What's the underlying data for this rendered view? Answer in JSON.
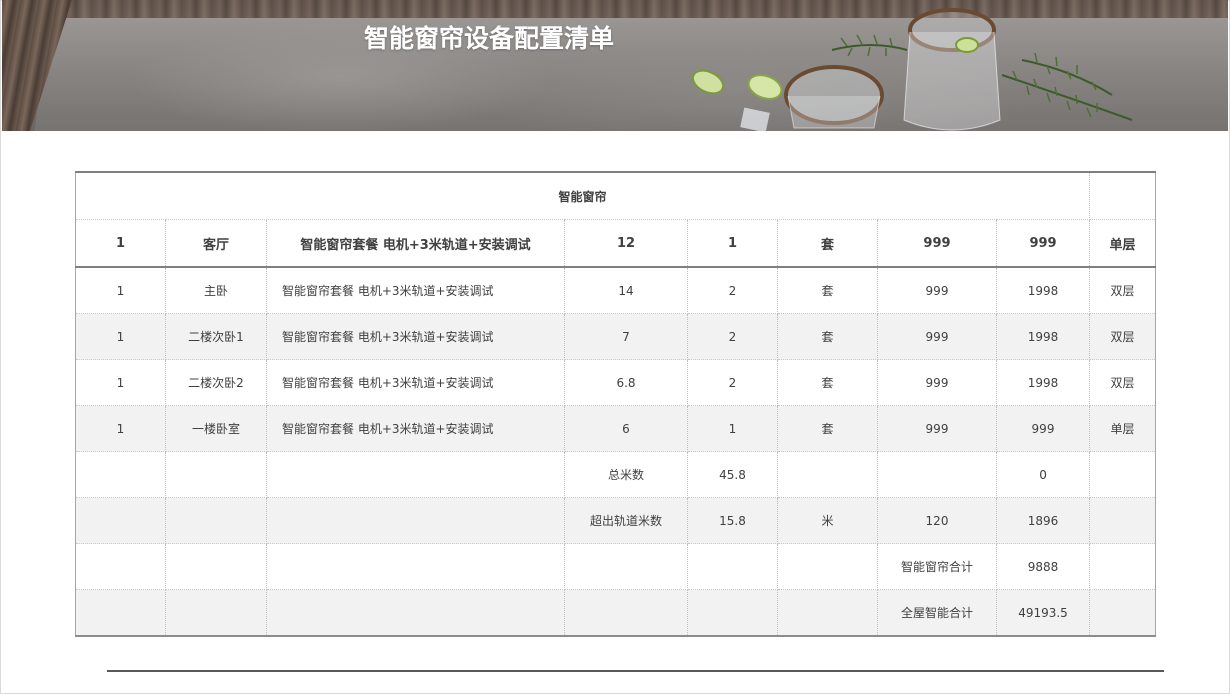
{
  "banner": {
    "title": "智能窗帘设备配置清单"
  },
  "table": {
    "section_title": "智能窗帘",
    "header": [
      "1",
      "客厅",
      "智能窗帘套餐 电机+3米轨道+安装调试",
      "12",
      "1",
      "套",
      "999",
      "999",
      "单层"
    ],
    "rows": [
      [
        "1",
        "主卧",
        "智能窗帘套餐 电机+3米轨道+安装调试",
        "14",
        "2",
        "套",
        "999",
        "1998",
        "双层"
      ],
      [
        "1",
        "二楼次卧1",
        "智能窗帘套餐 电机+3米轨道+安装调试",
        "7",
        "2",
        "套",
        "999",
        "1998",
        "双层"
      ],
      [
        "1",
        "二楼次卧2",
        "智能窗帘套餐 电机+3米轨道+安装调试",
        "6.8",
        "2",
        "套",
        "999",
        "1998",
        "双层"
      ],
      [
        "1",
        "一楼卧室",
        "智能窗帘套餐 电机+3米轨道+安装调试",
        "6",
        "1",
        "套",
        "999",
        "999",
        "单层"
      ],
      [
        "",
        "",
        "",
        "总米数",
        "45.8",
        "",
        "",
        "0",
        ""
      ],
      [
        "",
        "",
        "",
        "超出轨道米数",
        "15.8",
        "米",
        "120",
        "1896",
        ""
      ],
      [
        "",
        "",
        "",
        "",
        "",
        "",
        "智能窗帘合计",
        "9888",
        ""
      ],
      [
        "",
        "",
        "",
        "",
        "",
        "",
        "全屋智能合计",
        "49193.5",
        ""
      ]
    ]
  },
  "colors": {
    "zebra": "#f2f2f2",
    "border": "#7f7f7f",
    "text": "#404040"
  }
}
